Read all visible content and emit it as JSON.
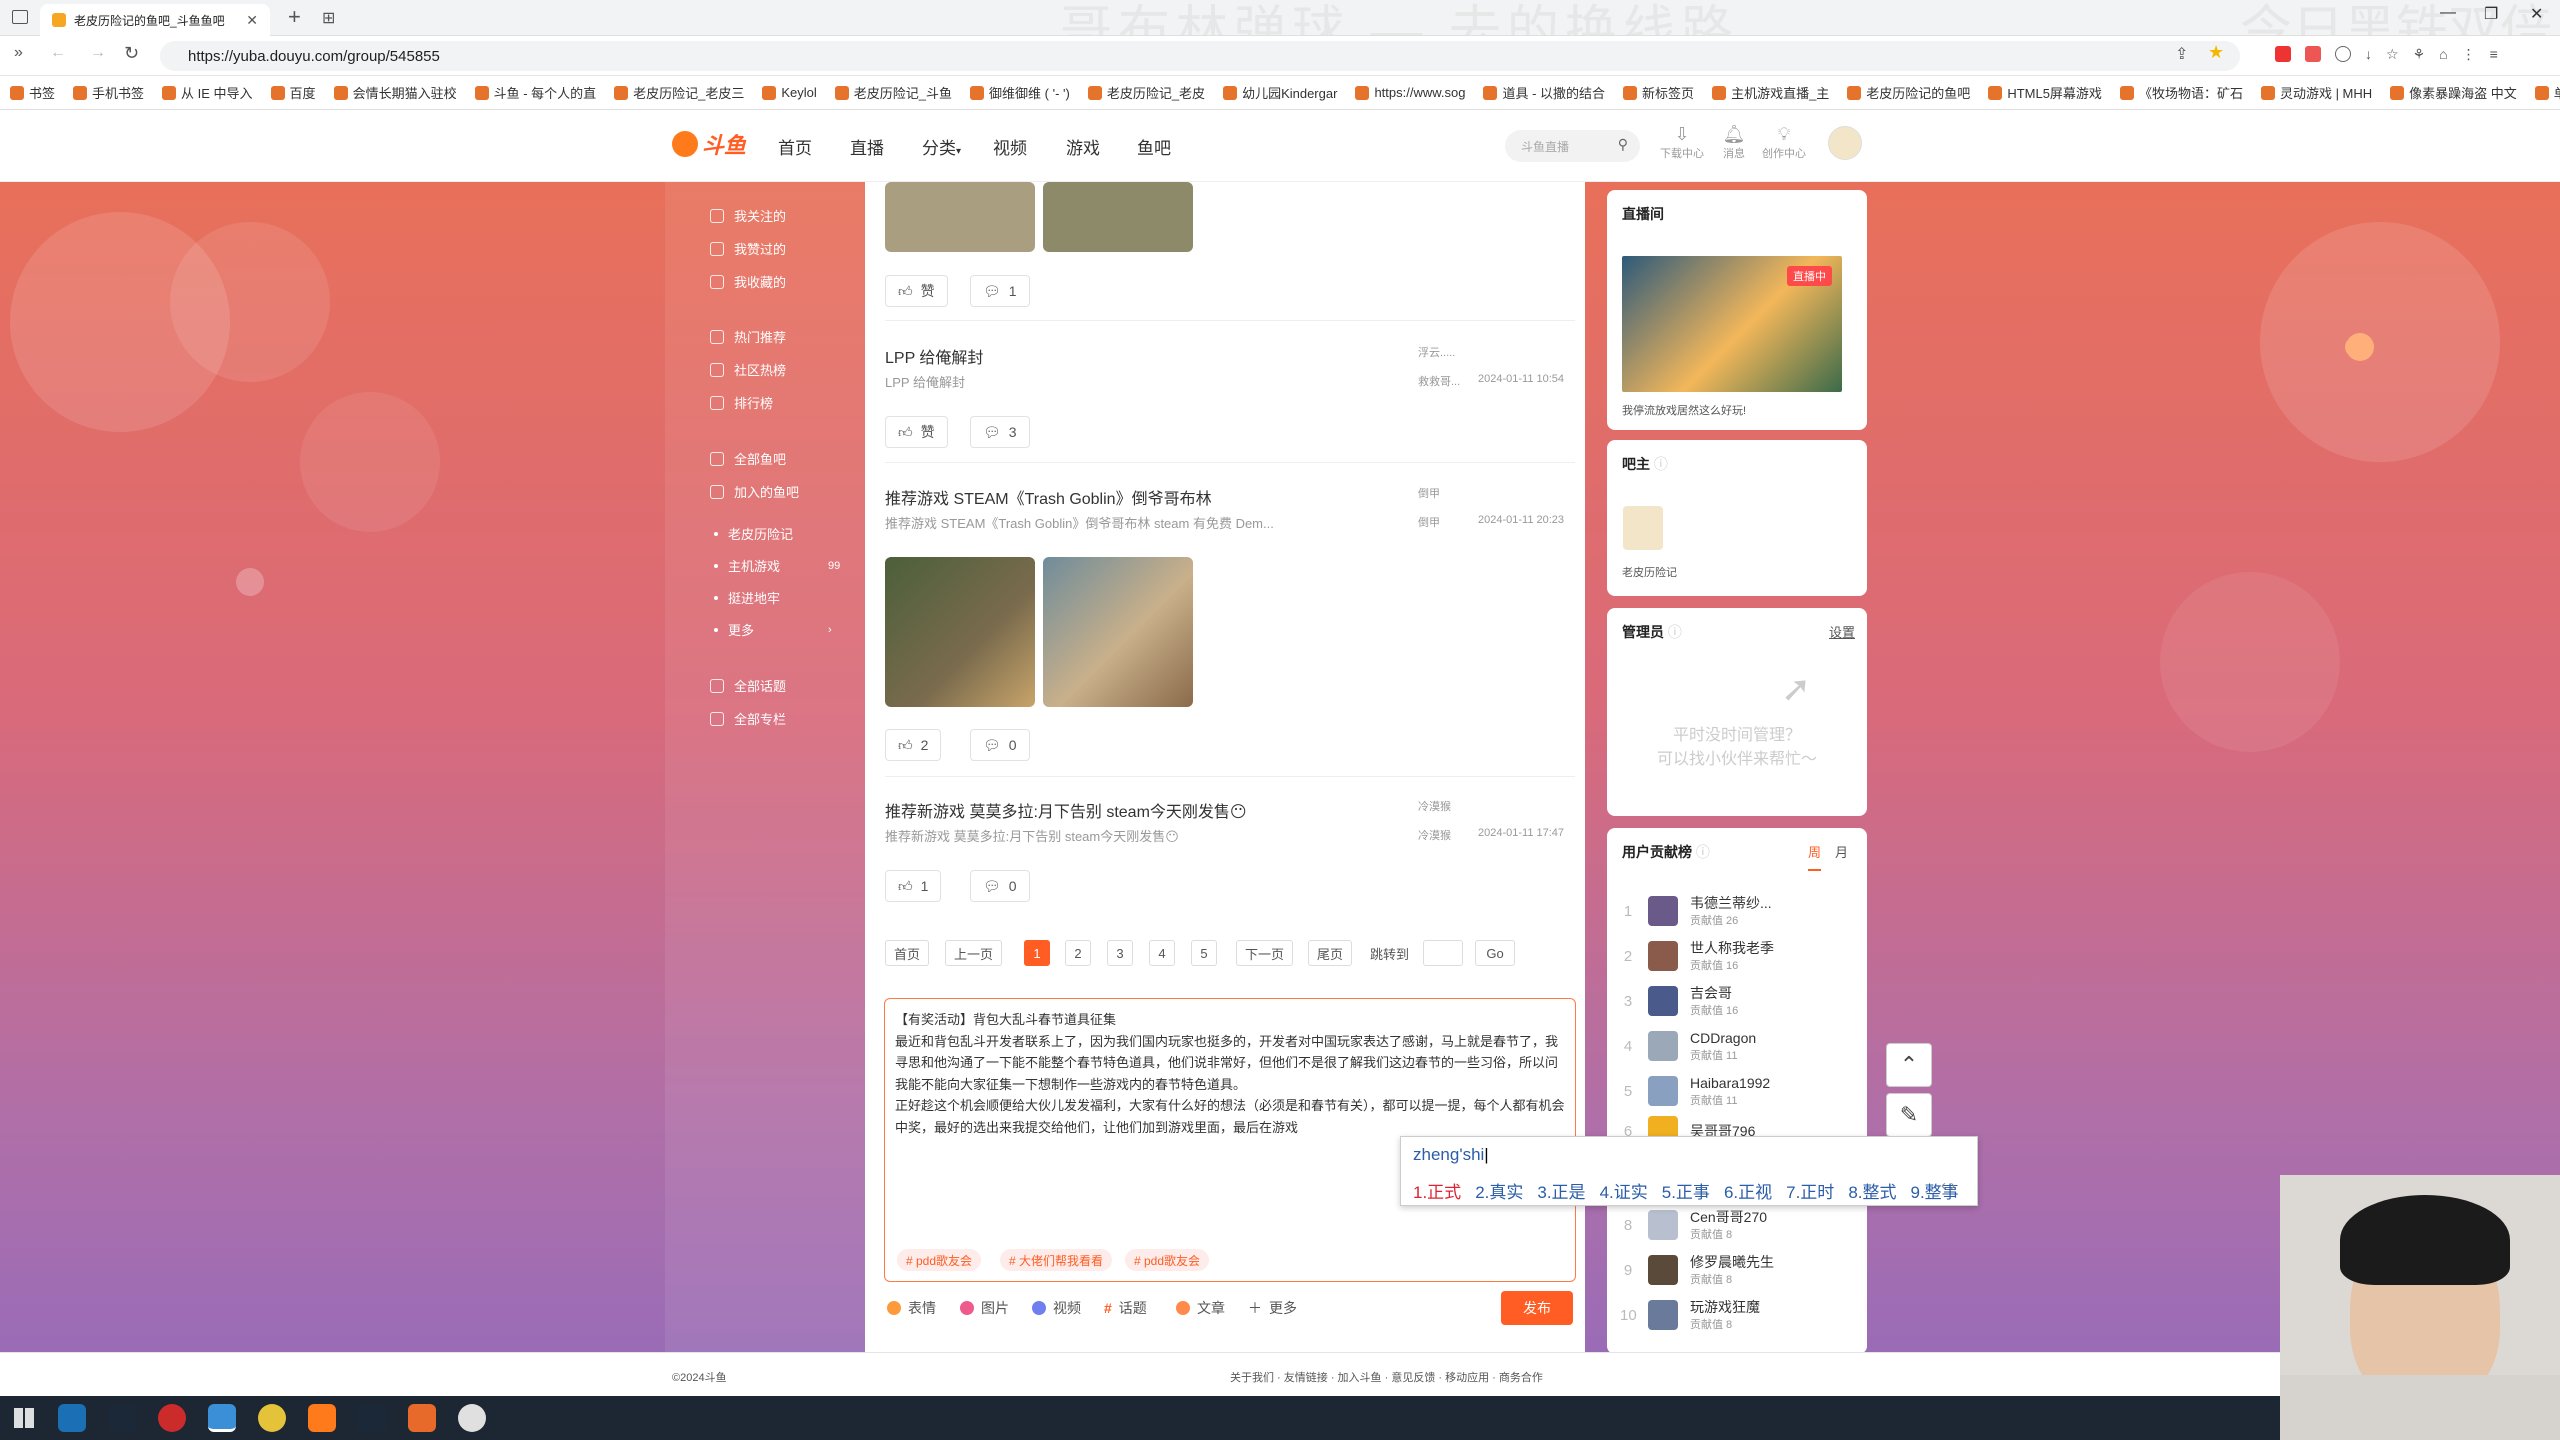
{
  "browser": {
    "tab_title": "老皮历险记的鱼吧_斗鱼鱼吧",
    "overlay_text": "哥布林弹球 — 去的换线路",
    "overlay_right": "今日黑铁双倍",
    "url": "https://yuba.douyu.com/group/545855",
    "bookmarks": [
      "书签",
      "手机书签",
      "从 IE 中导入",
      "百度",
      "会情长期猫入驻校",
      "斗鱼 - 每个人的直",
      "老皮历险记_老皮三",
      "Keylol",
      "老皮历险记_斗鱼",
      "御维御维 ( '- ')",
      "老皮历险记_老皮",
      "幼儿园Kindergar",
      "https://www.sog",
      "道具 - 以撒的结合",
      "新标签页",
      "主机游戏直播_主",
      "老皮历险记的鱼吧",
      "HTML5屏幕游戏",
      "《牧场物语：矿石",
      "灵动游戏 | MHH",
      "像素暴躁海盗 中文",
      "单机热游"
    ]
  },
  "header": {
    "logo": "斗鱼",
    "nav": [
      "首页",
      "直播",
      "分类",
      "视频",
      "游戏",
      "鱼吧"
    ],
    "search_placeholder": "斗鱼直播",
    "icons": [
      {
        "label": "下载中心",
        "name": "download-icon"
      },
      {
        "label": "消息",
        "name": "bell-icon"
      },
      {
        "label": "创作中心",
        "name": "bulb-icon"
      }
    ]
  },
  "sidebar": {
    "group1": [
      "我关注的",
      "我赞过的",
      "我收藏的"
    ],
    "group2": [
      "热门推荐",
      "社区热榜",
      "排行榜"
    ],
    "group3": [
      "全部鱼吧",
      "加入的鱼吧"
    ],
    "joined": [
      {
        "label": "老皮历险记",
        "badge": ""
      },
      {
        "label": "主机游戏",
        "badge": "99"
      },
      {
        "label": "挺进地牢",
        "badge": ""
      },
      {
        "label": "更多",
        "badge": "›"
      }
    ],
    "group4": [
      "全部话题",
      "全部专栏"
    ]
  },
  "posts": [
    {
      "title": "",
      "likes": "赞",
      "comments": "1"
    },
    {
      "title": "LPP 给俺解封",
      "sub": "LPP 给俺解封",
      "author": "浮云.....",
      "last": "救救哥...",
      "date": "2024-01-11 10:54",
      "likes": "赞",
      "comments": "3"
    },
    {
      "title": "推荐游戏 STEAM《Trash Goblin》倒爷哥布林",
      "sub": "推荐游戏 STEAM《Trash Goblin》倒爷哥布林 steam 有免费 Dem...",
      "author": "倒甲",
      "last": "倒甲",
      "date": "2024-01-11 20:23",
      "likes": "2",
      "comments": "0"
    },
    {
      "title": "推荐新游戏 莫莫多拉:月下告别 steam今天刚发售😶",
      "sub": "推荐新游戏 莫莫多拉:月下告别 steam今天刚发售😶",
      "author": "冷漠猴",
      "last": "冷漠猴",
      "date": "2024-01-11 17:47",
      "likes": "1",
      "comments": "0"
    }
  ],
  "pagination": {
    "first": "首页",
    "prev": "上一页",
    "pages": [
      "1",
      "2",
      "3",
      "4",
      "5"
    ],
    "next": "下一页",
    "last": "尾页",
    "jump": "跳转到",
    "go": "Go"
  },
  "editor": {
    "text": "【有奖活动】背包大乱斗春节道具征集\n最近和背包乱斗开发者联系上了，因为我们国内玩家也挺多的，开发者对中国玩家表达了感谢，马上就是春节了，我寻思和他沟通了一下能不能整个春节特色道具，他们说非常好，但他们不是很了解我们这边春节的一些习俗，所以问我能不能向大家征集一下想制作一些游戏内的春节特色道具。\n正好趁这个机会顺便给大伙儿发发福利，大家有什么好的想法（必须是和春节有关），都可以提一提，每个人都有机会中奖，最好的选出来我提交给他们，让他们加到游戏里面，最后在游戏",
    "tags": [
      "# pdd歌友会",
      "# 大佬们帮我看看",
      "# pdd歌友会"
    ],
    "tools": [
      "表情",
      "图片",
      "视频",
      "话题",
      "文章",
      "更多"
    ],
    "publish": "发布"
  },
  "ime": {
    "input": "zheng'shi",
    "candidates": [
      "1.正式",
      "2.真实",
      "3.正是",
      "4.证实",
      "5.正事",
      "6.正视",
      "7.正时",
      "8.整式",
      "9.整事"
    ]
  },
  "right": {
    "live": {
      "title": "直播间",
      "badge": "直播中",
      "caption": "我停流放戏居然这么好玩!"
    },
    "owner": {
      "title": "吧主",
      "name": "老皮历险记"
    },
    "admin": {
      "title": "管理员",
      "settings": "设置",
      "empty": "平时没时间管理？\n可以找小伙伴来帮忙～"
    },
    "ranking": {
      "title": "用户贡献榜",
      "tab_week": "周",
      "tab_month": "月",
      "rows": [
        {
          "n": "1",
          "name": "韦德兰蒂纱...",
          "score": "贡献值 26"
        },
        {
          "n": "2",
          "name": "世人称我老季",
          "score": "贡献值 16"
        },
        {
          "n": "3",
          "name": "吉会哥",
          "score": "贡献值 16"
        },
        {
          "n": "4",
          "name": "CDDragon",
          "score": "贡献值 11"
        },
        {
          "n": "5",
          "name": "Haibara1992",
          "score": "贡献值 11"
        },
        {
          "n": "6",
          "name": "吴哥哥796",
          "score": ""
        },
        {
          "n": "8",
          "name": "Cen哥哥270",
          "score": "贡献值 8"
        },
        {
          "n": "9",
          "name": "修罗晨曦先生",
          "score": "贡献值 8"
        },
        {
          "n": "10",
          "name": "玩游戏狂魔",
          "score": "贡献值 8"
        }
      ]
    }
  },
  "footer": {
    "copyright": "©2024斗鱼",
    "links": "关于我们 · 友情链接 · 加入斗鱼 · 意见反馈 · 移动应用 · 商务合作"
  }
}
